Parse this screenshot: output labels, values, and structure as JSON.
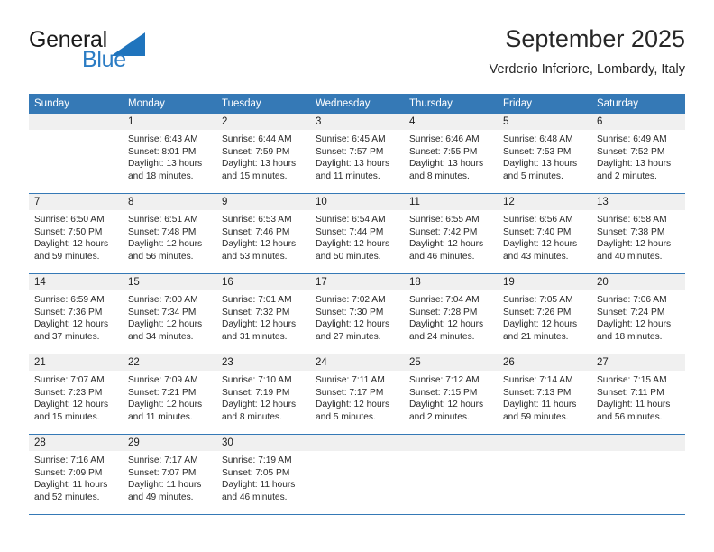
{
  "brand": {
    "name_part1": "General",
    "name_part2": "Blue",
    "triangle_icon": "blue-triangle-icon",
    "color_dark": "#1a1a1a",
    "color_blue": "#2b7cc4"
  },
  "header": {
    "title": "September 2025",
    "subtitle": "Verderio Inferiore, Lombardy, Italy"
  },
  "theme": {
    "header_blue": "#3579b6",
    "band_gray": "#f0f0f0",
    "text": "#2a2a2a"
  },
  "weekdays": [
    "Sunday",
    "Monday",
    "Tuesday",
    "Wednesday",
    "Thursday",
    "Friday",
    "Saturday"
  ],
  "weeks": [
    {
      "days": [
        {
          "num": "",
          "sunrise": "",
          "sunset": "",
          "daylight": "",
          "empty": true
        },
        {
          "num": "1",
          "sunrise": "Sunrise: 6:43 AM",
          "sunset": "Sunset: 8:01 PM",
          "daylight": "Daylight: 13 hours and 18 minutes."
        },
        {
          "num": "2",
          "sunrise": "Sunrise: 6:44 AM",
          "sunset": "Sunset: 7:59 PM",
          "daylight": "Daylight: 13 hours and 15 minutes."
        },
        {
          "num": "3",
          "sunrise": "Sunrise: 6:45 AM",
          "sunset": "Sunset: 7:57 PM",
          "daylight": "Daylight: 13 hours and 11 minutes."
        },
        {
          "num": "4",
          "sunrise": "Sunrise: 6:46 AM",
          "sunset": "Sunset: 7:55 PM",
          "daylight": "Daylight: 13 hours and 8 minutes."
        },
        {
          "num": "5",
          "sunrise": "Sunrise: 6:48 AM",
          "sunset": "Sunset: 7:53 PM",
          "daylight": "Daylight: 13 hours and 5 minutes."
        },
        {
          "num": "6",
          "sunrise": "Sunrise: 6:49 AM",
          "sunset": "Sunset: 7:52 PM",
          "daylight": "Daylight: 13 hours and 2 minutes."
        }
      ]
    },
    {
      "days": [
        {
          "num": "7",
          "sunrise": "Sunrise: 6:50 AM",
          "sunset": "Sunset: 7:50 PM",
          "daylight": "Daylight: 12 hours and 59 minutes."
        },
        {
          "num": "8",
          "sunrise": "Sunrise: 6:51 AM",
          "sunset": "Sunset: 7:48 PM",
          "daylight": "Daylight: 12 hours and 56 minutes."
        },
        {
          "num": "9",
          "sunrise": "Sunrise: 6:53 AM",
          "sunset": "Sunset: 7:46 PM",
          "daylight": "Daylight: 12 hours and 53 minutes."
        },
        {
          "num": "10",
          "sunrise": "Sunrise: 6:54 AM",
          "sunset": "Sunset: 7:44 PM",
          "daylight": "Daylight: 12 hours and 50 minutes."
        },
        {
          "num": "11",
          "sunrise": "Sunrise: 6:55 AM",
          "sunset": "Sunset: 7:42 PM",
          "daylight": "Daylight: 12 hours and 46 minutes."
        },
        {
          "num": "12",
          "sunrise": "Sunrise: 6:56 AM",
          "sunset": "Sunset: 7:40 PM",
          "daylight": "Daylight: 12 hours and 43 minutes."
        },
        {
          "num": "13",
          "sunrise": "Sunrise: 6:58 AM",
          "sunset": "Sunset: 7:38 PM",
          "daylight": "Daylight: 12 hours and 40 minutes."
        }
      ]
    },
    {
      "days": [
        {
          "num": "14",
          "sunrise": "Sunrise: 6:59 AM",
          "sunset": "Sunset: 7:36 PM",
          "daylight": "Daylight: 12 hours and 37 minutes."
        },
        {
          "num": "15",
          "sunrise": "Sunrise: 7:00 AM",
          "sunset": "Sunset: 7:34 PM",
          "daylight": "Daylight: 12 hours and 34 minutes."
        },
        {
          "num": "16",
          "sunrise": "Sunrise: 7:01 AM",
          "sunset": "Sunset: 7:32 PM",
          "daylight": "Daylight: 12 hours and 31 minutes."
        },
        {
          "num": "17",
          "sunrise": "Sunrise: 7:02 AM",
          "sunset": "Sunset: 7:30 PM",
          "daylight": "Daylight: 12 hours and 27 minutes."
        },
        {
          "num": "18",
          "sunrise": "Sunrise: 7:04 AM",
          "sunset": "Sunset: 7:28 PM",
          "daylight": "Daylight: 12 hours and 24 minutes."
        },
        {
          "num": "19",
          "sunrise": "Sunrise: 7:05 AM",
          "sunset": "Sunset: 7:26 PM",
          "daylight": "Daylight: 12 hours and 21 minutes."
        },
        {
          "num": "20",
          "sunrise": "Sunrise: 7:06 AM",
          "sunset": "Sunset: 7:24 PM",
          "daylight": "Daylight: 12 hours and 18 minutes."
        }
      ]
    },
    {
      "days": [
        {
          "num": "21",
          "sunrise": "Sunrise: 7:07 AM",
          "sunset": "Sunset: 7:23 PM",
          "daylight": "Daylight: 12 hours and 15 minutes."
        },
        {
          "num": "22",
          "sunrise": "Sunrise: 7:09 AM",
          "sunset": "Sunset: 7:21 PM",
          "daylight": "Daylight: 12 hours and 11 minutes."
        },
        {
          "num": "23",
          "sunrise": "Sunrise: 7:10 AM",
          "sunset": "Sunset: 7:19 PM",
          "daylight": "Daylight: 12 hours and 8 minutes."
        },
        {
          "num": "24",
          "sunrise": "Sunrise: 7:11 AM",
          "sunset": "Sunset: 7:17 PM",
          "daylight": "Daylight: 12 hours and 5 minutes."
        },
        {
          "num": "25",
          "sunrise": "Sunrise: 7:12 AM",
          "sunset": "Sunset: 7:15 PM",
          "daylight": "Daylight: 12 hours and 2 minutes."
        },
        {
          "num": "26",
          "sunrise": "Sunrise: 7:14 AM",
          "sunset": "Sunset: 7:13 PM",
          "daylight": "Daylight: 11 hours and 59 minutes."
        },
        {
          "num": "27",
          "sunrise": "Sunrise: 7:15 AM",
          "sunset": "Sunset: 7:11 PM",
          "daylight": "Daylight: 11 hours and 56 minutes."
        }
      ]
    },
    {
      "days": [
        {
          "num": "28",
          "sunrise": "Sunrise: 7:16 AM",
          "sunset": "Sunset: 7:09 PM",
          "daylight": "Daylight: 11 hours and 52 minutes."
        },
        {
          "num": "29",
          "sunrise": "Sunrise: 7:17 AM",
          "sunset": "Sunset: 7:07 PM",
          "daylight": "Daylight: 11 hours and 49 minutes."
        },
        {
          "num": "30",
          "sunrise": "Sunrise: 7:19 AM",
          "sunset": "Sunset: 7:05 PM",
          "daylight": "Daylight: 11 hours and 46 minutes."
        },
        {
          "num": "",
          "sunrise": "",
          "sunset": "",
          "daylight": "",
          "empty": true
        },
        {
          "num": "",
          "sunrise": "",
          "sunset": "",
          "daylight": "",
          "empty": true
        },
        {
          "num": "",
          "sunrise": "",
          "sunset": "",
          "daylight": "",
          "empty": true
        },
        {
          "num": "",
          "sunrise": "",
          "sunset": "",
          "daylight": "",
          "empty": true
        }
      ]
    }
  ]
}
